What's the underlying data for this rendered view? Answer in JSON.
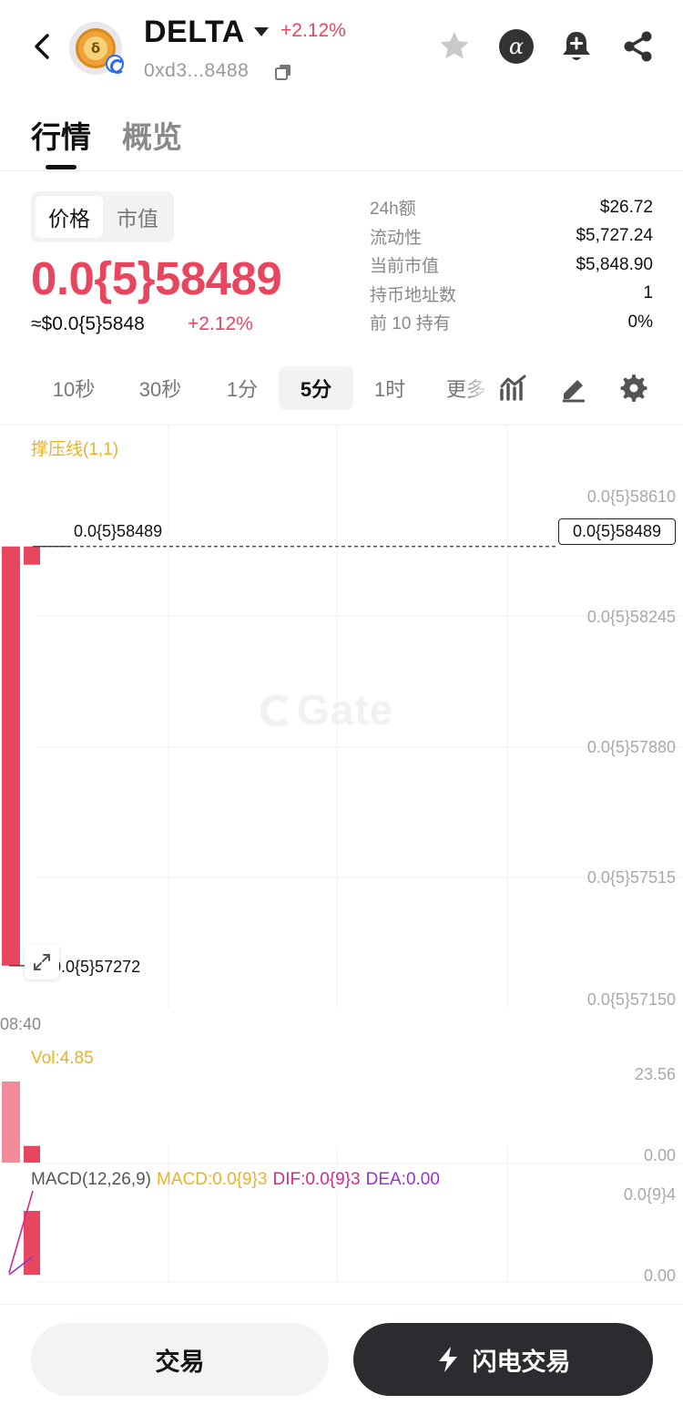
{
  "header": {
    "token_name": "DELTA",
    "change": "+2.12%",
    "address": "0xd3...8488",
    "logo_glyph": "δ",
    "icons": [
      "back-arrow-icon",
      "caret-down-icon",
      "copy-icon",
      "star-icon",
      "alpha-icon",
      "bell-plus-icon",
      "share-icon"
    ],
    "alpha_glyph": "α"
  },
  "tabs": [
    {
      "label": "行情",
      "active": true
    },
    {
      "label": "概览",
      "active": false
    }
  ],
  "price_panel": {
    "toggle": [
      "价格",
      "市值"
    ],
    "price": "0.0{5}58489",
    "usd_price": "≈$0.0{5}5848",
    "usd_change": "+2.12%"
  },
  "stats": [
    {
      "label": "24h额",
      "value": "$26.72"
    },
    {
      "label": "流动性",
      "value": "$5,727.24"
    },
    {
      "label": "当前市值",
      "value": "$5,848.90"
    },
    {
      "label": "持币地址数",
      "value": "1"
    },
    {
      "label": "前 10 持有",
      "value": "0%"
    }
  ],
  "intervals": [
    {
      "label": "10秒",
      "active": false
    },
    {
      "label": "30秒",
      "active": false
    },
    {
      "label": "1分",
      "active": false
    },
    {
      "label": "5分",
      "active": true
    },
    {
      "label": "1时",
      "active": false
    },
    {
      "label": "更多",
      "active": false
    }
  ],
  "chart": {
    "indicator": "撑压线(1,1)",
    "price_axis": [
      "0.0{5}58610",
      "0.0{5}58245",
      "0.0{5}57880",
      "0.0{5}57515",
      "0.0{5}57150"
    ],
    "current_price": "0.0{5}58489",
    "high_label": "0.0{5}58489",
    "low_label": "0.0{5}57272",
    "time_label": "08:40",
    "watermark": "Gate",
    "volume_label": "Vol:4.85",
    "volume_axis": [
      "23.56",
      "0.00"
    ],
    "macd": {
      "name": "MACD(12,26,9)",
      "macd": "MACD:0.0{9}3",
      "dif": "DIF:0.0{9}3",
      "dea": "DEA:0.00",
      "axis": [
        "0.0{9}4",
        "0.00"
      ]
    },
    "colors": {
      "up": "#e8465e",
      "indicator": "#e9b328",
      "dif": "#d4288a",
      "dea": "#9b2fd4"
    }
  },
  "chart_data": {
    "type": "candlestick",
    "interval": "5分",
    "ylim": [
      5.715e-06,
      5.861e-06
    ],
    "candles": [
      {
        "open": 5.7272e-06,
        "close": 5.8489e-06,
        "high": 5.8489e-06,
        "low": 5.7272e-06
      },
      {
        "open": 5.8489e-06,
        "close": 5.8489e-06,
        "high": 5.8489e-06,
        "low": 5.8489e-06
      }
    ],
    "volume": [
      23.56,
      4.85
    ]
  },
  "bottom": {
    "trade": "交易",
    "flash_trade": "闪电交易"
  }
}
